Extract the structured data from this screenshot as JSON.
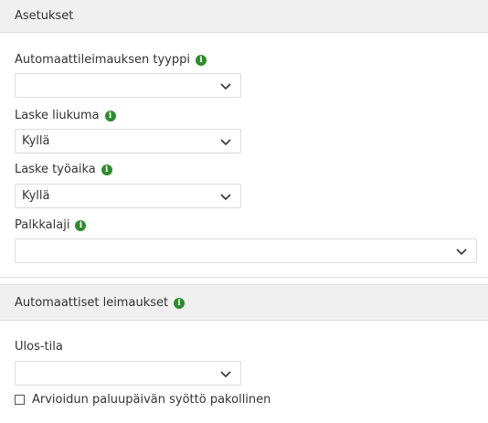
{
  "sections": {
    "settings": {
      "title": "Asetukset"
    },
    "auto_stamps": {
      "title": "Automaattiset leimaukset"
    }
  },
  "fields": {
    "auto_stamp_type": {
      "label": "Automaattileimauksen tyyppi",
      "value": ""
    },
    "calc_flex": {
      "label": "Laske liukuma",
      "value": "Kyllä"
    },
    "calc_worktime": {
      "label": "Laske työaika",
      "value": "Kyllä"
    },
    "pay_type": {
      "label": "Palkkalaji",
      "value": ""
    },
    "out_state": {
      "label": "Ulos-tila",
      "value": ""
    }
  },
  "checkbox": {
    "label": "Arvioidun paluupäivän syöttö pakollinen",
    "checked": false
  },
  "icons": {
    "info": "info-icon",
    "dropdown": "chevron-down-icon"
  },
  "colors": {
    "info_icon": "#2e8b2e",
    "header_bg": "#f0f0f0",
    "border": "#dcdcdc"
  }
}
